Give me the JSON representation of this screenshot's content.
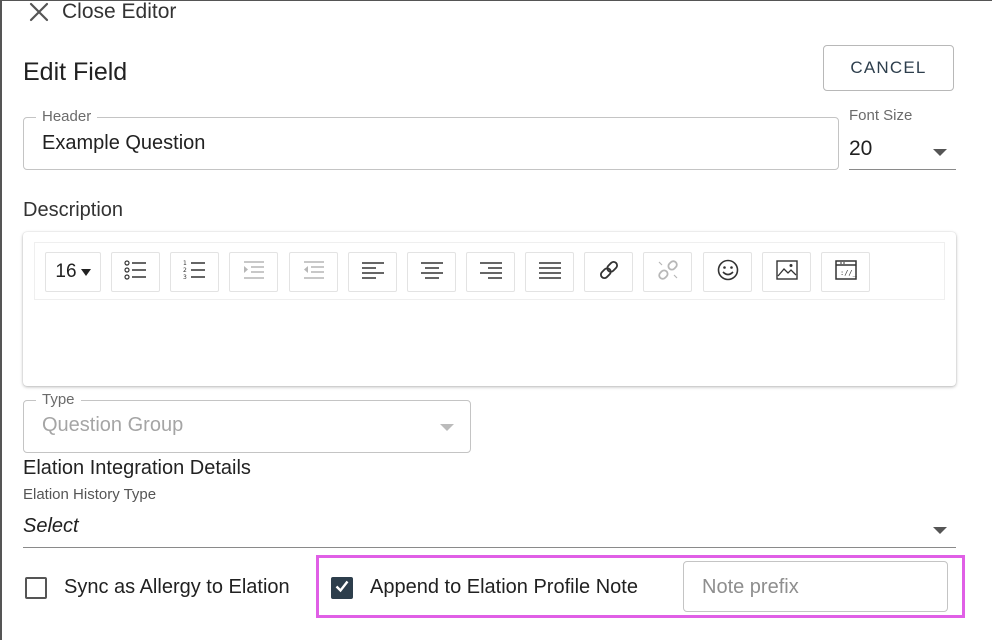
{
  "header_bar": {
    "close_label": "Close Editor"
  },
  "page": {
    "title": "Edit Field",
    "cancel_label": "CANCEL"
  },
  "header_field": {
    "label": "Header",
    "value": "Example Question"
  },
  "font_size": {
    "label": "Font Size",
    "value": "20"
  },
  "description": {
    "label": "Description",
    "toolbar": {
      "font_size": "16",
      "buttons": [
        {
          "icon": "unordered-list-icon"
        },
        {
          "icon": "ordered-list-icon"
        },
        {
          "icon": "indent-icon",
          "disabled": true
        },
        {
          "icon": "outdent-icon",
          "disabled": true
        },
        {
          "icon": "align-left-icon"
        },
        {
          "icon": "align-center-icon"
        },
        {
          "icon": "align-right-icon"
        },
        {
          "icon": "align-justify-icon"
        },
        {
          "icon": "link-icon"
        },
        {
          "icon": "unlink-icon",
          "disabled": true
        },
        {
          "icon": "emoji-icon"
        },
        {
          "icon": "image-icon"
        },
        {
          "icon": "embed-icon"
        }
      ]
    }
  },
  "type_field": {
    "label": "Type",
    "value": "Question Group"
  },
  "elation": {
    "section_title": "Elation Integration Details",
    "history_type_label": "Elation History Type",
    "history_type_value": "Select",
    "sync_allergy_label": "Sync as Allergy to Elation",
    "sync_allergy_checked": false,
    "append_note_label": "Append to Elation Profile Note",
    "append_note_checked": true,
    "note_prefix_placeholder": "Note prefix"
  },
  "colors": {
    "accent": "#2d3e4c",
    "highlight": "#e05fe6",
    "border": "#c4c4c4"
  }
}
